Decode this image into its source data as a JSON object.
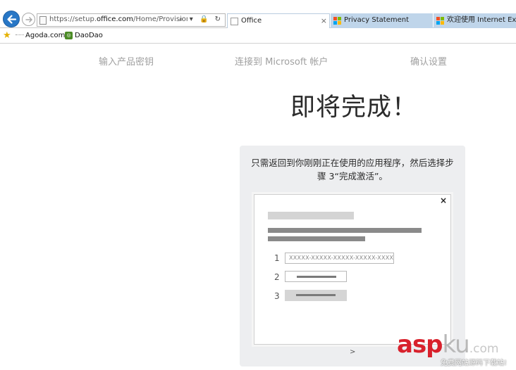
{
  "browser": {
    "url_prefix": "https://setup.",
    "url_domain": "office.com",
    "url_rest": "/Home/Provision?ctid=",
    "address_controls": "⌕ ▾ 🔒 ↻",
    "tabs": [
      {
        "label": "Office",
        "close": "×"
      },
      {
        "label": "Privacy Statement"
      },
      {
        "label": "欢迎使用 Internet Explorer"
      }
    ],
    "favorites": [
      {
        "label": "Agoda.com"
      },
      {
        "label": "DaoDao"
      }
    ],
    "colors": {
      "accent": "#2877c6",
      "tab_inactive": "#bfd5ea"
    }
  },
  "steps": [
    "输入产品密钥",
    "连接到 Microsoft 帐户",
    "确认设置"
  ],
  "page_title": "即将完成！",
  "instruction": "只需返回到你刚刚正在使用的应用程序，然后选择步骤 3“完成激活”。",
  "dialog": {
    "close": "×",
    "numbers": [
      "1",
      "2",
      "3"
    ],
    "key_placeholder": "XXXXX-XXXXX-XXXXX-XXXXX-XXXXX"
  },
  "next_arrow": ">",
  "watermark": {
    "brand_red": "asp",
    "brand_light": "ku",
    "brand_domain": ".com",
    "sub": "免费网站源码下载站!"
  }
}
